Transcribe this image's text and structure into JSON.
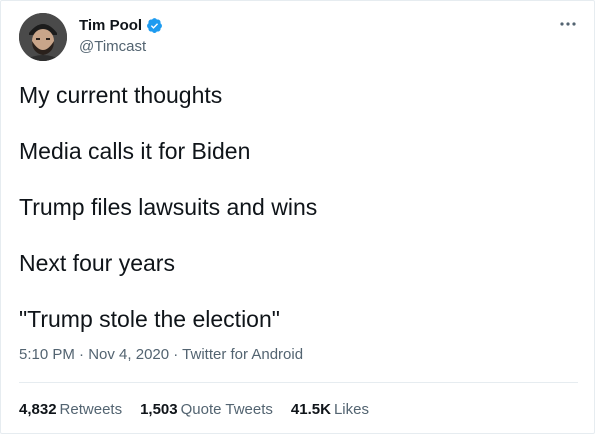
{
  "author": {
    "display_name": "Tim Pool",
    "handle": "@Timcast",
    "verified_icon": "verified-badge-icon",
    "verified_color": "#1d9bf0"
  },
  "tweet": {
    "lines": [
      "My current thoughts",
      "Media calls it for Biden",
      "Trump files lawsuits and wins",
      "Next four years",
      "\"Trump stole the election\""
    ]
  },
  "meta": {
    "time": "5:10 PM",
    "separator1": " · ",
    "date": "Nov 4, 2020",
    "separator2": " · ",
    "source": "Twitter for Android"
  },
  "stats": {
    "retweets_count": "4,832",
    "retweets_label": "Retweets",
    "quote_tweets_count": "1,503",
    "quote_tweets_label": "Quote Tweets",
    "likes_count": "41.5K",
    "likes_label": "Likes"
  },
  "icons": {
    "more": "more-horizontal-icon"
  }
}
